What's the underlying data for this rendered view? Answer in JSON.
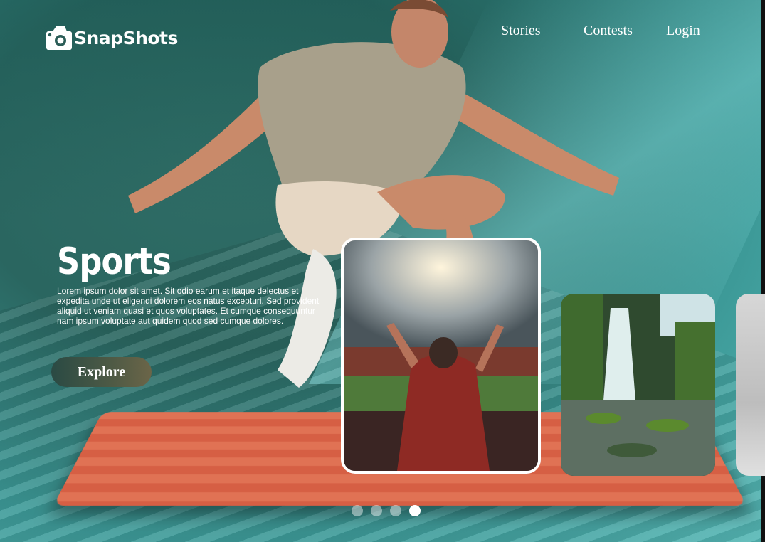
{
  "brand": {
    "logo_text": "SnapShots",
    "logo_icon": "camera-icon"
  },
  "nav": {
    "items": [
      {
        "label": "Stories"
      },
      {
        "label": "Contests"
      },
      {
        "label": "Login"
      }
    ]
  },
  "hero": {
    "title": "Sports",
    "description": "Lorem ipsum dolor sit amet. Sit odio earum et itaque delectus et expedita unde ut eligendi dolorem eos natus excepturi. Sed provident aliquid ut veniam quasi et quos voluptates. Et cumque consequuntur nam ipsum voluptate aut quidem quod sed cumque dolores.",
    "button_label": "Explore"
  },
  "carousel": {
    "cards": [
      {
        "subject": "stadium-fan-photo"
      },
      {
        "subject": "waterfall-photo"
      },
      {
        "subject": "partial-photo"
      }
    ],
    "dots": 4,
    "active_index": 3
  },
  "colors": {
    "background": "#2f6d66",
    "mat": "#e07254",
    "text": "#ffffff",
    "button": "#3e5148"
  }
}
